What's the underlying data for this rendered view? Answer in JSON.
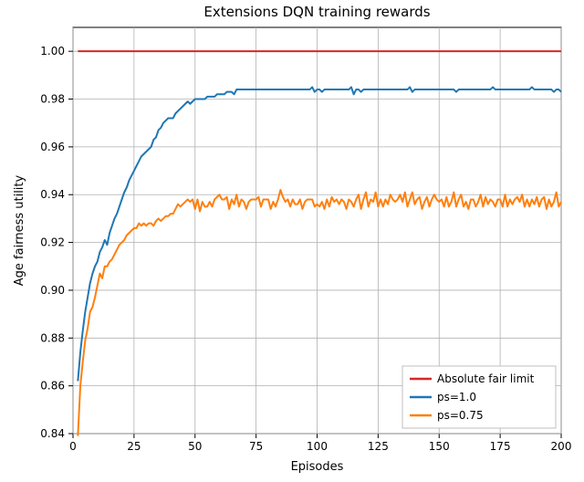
{
  "chart_data": {
    "type": "line",
    "title": "Extensions DQN training rewards",
    "xlabel": "Episodes",
    "ylabel": "Age fairness utility",
    "xlim": [
      0,
      200
    ],
    "ylim": [
      0.84,
      1.01
    ],
    "xticks": [
      0,
      25,
      50,
      75,
      100,
      125,
      150,
      175,
      200
    ],
    "yticks": [
      0.84,
      0.86,
      0.88,
      0.9,
      0.92,
      0.94,
      0.96,
      0.98,
      1.0
    ],
    "x": [
      2,
      3,
      4,
      5,
      6,
      7,
      8,
      9,
      10,
      11,
      12,
      13,
      14,
      15,
      16,
      17,
      18,
      19,
      20,
      21,
      22,
      23,
      24,
      25,
      26,
      27,
      28,
      29,
      30,
      31,
      32,
      33,
      34,
      35,
      36,
      37,
      38,
      39,
      40,
      41,
      42,
      43,
      44,
      45,
      46,
      47,
      48,
      49,
      50,
      51,
      52,
      53,
      54,
      55,
      56,
      57,
      58,
      59,
      60,
      61,
      62,
      63,
      64,
      65,
      66,
      67,
      68,
      69,
      70,
      71,
      72,
      73,
      74,
      75,
      76,
      77,
      78,
      79,
      80,
      81,
      82,
      83,
      84,
      85,
      86,
      87,
      88,
      89,
      90,
      91,
      92,
      93,
      94,
      95,
      96,
      97,
      98,
      99,
      100,
      101,
      102,
      103,
      104,
      105,
      106,
      107,
      108,
      109,
      110,
      111,
      112,
      113,
      114,
      115,
      116,
      117,
      118,
      119,
      120,
      121,
      122,
      123,
      124,
      125,
      126,
      127,
      128,
      129,
      130,
      131,
      132,
      133,
      134,
      135,
      136,
      137,
      138,
      139,
      140,
      141,
      142,
      143,
      144,
      145,
      146,
      147,
      148,
      149,
      150,
      151,
      152,
      153,
      154,
      155,
      156,
      157,
      158,
      159,
      160,
      161,
      162,
      163,
      164,
      165,
      166,
      167,
      168,
      169,
      170,
      171,
      172,
      173,
      174,
      175,
      176,
      177,
      178,
      179,
      180,
      181,
      182,
      183,
      184,
      185,
      186,
      187,
      188,
      189,
      190,
      191,
      192,
      193,
      194,
      195,
      196,
      197,
      198,
      199,
      200
    ],
    "series": [
      {
        "name": "Absolute fair limit",
        "color": "#d62728",
        "values": [
          1.0,
          1.0,
          1.0,
          1.0,
          1.0,
          1.0,
          1.0,
          1.0,
          1.0,
          1.0,
          1.0,
          1.0,
          1.0,
          1.0,
          1.0,
          1.0,
          1.0,
          1.0,
          1.0,
          1.0,
          1.0,
          1.0,
          1.0,
          1.0,
          1.0,
          1.0,
          1.0,
          1.0,
          1.0,
          1.0,
          1.0,
          1.0,
          1.0,
          1.0,
          1.0,
          1.0,
          1.0,
          1.0,
          1.0,
          1.0,
          1.0,
          1.0,
          1.0,
          1.0,
          1.0,
          1.0,
          1.0,
          1.0,
          1.0,
          1.0,
          1.0,
          1.0,
          1.0,
          1.0,
          1.0,
          1.0,
          1.0,
          1.0,
          1.0,
          1.0,
          1.0,
          1.0,
          1.0,
          1.0,
          1.0,
          1.0,
          1.0,
          1.0,
          1.0,
          1.0,
          1.0,
          1.0,
          1.0,
          1.0,
          1.0,
          1.0,
          1.0,
          1.0,
          1.0,
          1.0,
          1.0,
          1.0,
          1.0,
          1.0,
          1.0,
          1.0,
          1.0,
          1.0,
          1.0,
          1.0,
          1.0,
          1.0,
          1.0,
          1.0,
          1.0,
          1.0,
          1.0,
          1.0,
          1.0,
          1.0,
          1.0,
          1.0,
          1.0,
          1.0,
          1.0,
          1.0,
          1.0,
          1.0,
          1.0,
          1.0,
          1.0,
          1.0,
          1.0,
          1.0,
          1.0,
          1.0,
          1.0,
          1.0,
          1.0,
          1.0,
          1.0,
          1.0,
          1.0,
          1.0,
          1.0,
          1.0,
          1.0,
          1.0,
          1.0,
          1.0,
          1.0,
          1.0,
          1.0,
          1.0,
          1.0,
          1.0,
          1.0,
          1.0,
          1.0,
          1.0,
          1.0,
          1.0,
          1.0,
          1.0,
          1.0,
          1.0,
          1.0,
          1.0,
          1.0,
          1.0,
          1.0,
          1.0,
          1.0,
          1.0,
          1.0,
          1.0,
          1.0,
          1.0,
          1.0,
          1.0,
          1.0,
          1.0,
          1.0,
          1.0,
          1.0,
          1.0,
          1.0,
          1.0,
          1.0,
          1.0,
          1.0,
          1.0,
          1.0,
          1.0,
          1.0,
          1.0,
          1.0,
          1.0,
          1.0,
          1.0,
          1.0,
          1.0,
          1.0,
          1.0,
          1.0,
          1.0,
          1.0,
          1.0,
          1.0,
          1.0,
          1.0,
          1.0,
          1.0,
          1.0,
          1.0,
          1.0,
          1.0,
          1.0,
          1.0
        ]
      },
      {
        "name": "ps=1.0",
        "color": "#1f77b4",
        "values": [
          0.862,
          0.874,
          0.883,
          0.891,
          0.897,
          0.903,
          0.907,
          0.91,
          0.912,
          0.916,
          0.918,
          0.921,
          0.919,
          0.924,
          0.927,
          0.93,
          0.932,
          0.935,
          0.938,
          0.941,
          0.943,
          0.946,
          0.948,
          0.95,
          0.952,
          0.954,
          0.956,
          0.957,
          0.958,
          0.959,
          0.96,
          0.963,
          0.964,
          0.967,
          0.968,
          0.97,
          0.971,
          0.972,
          0.972,
          0.972,
          0.974,
          0.975,
          0.976,
          0.977,
          0.978,
          0.979,
          0.978,
          0.979,
          0.98,
          0.98,
          0.98,
          0.98,
          0.98,
          0.981,
          0.981,
          0.981,
          0.981,
          0.982,
          0.982,
          0.982,
          0.982,
          0.983,
          0.983,
          0.983,
          0.982,
          0.984,
          0.984,
          0.984,
          0.984,
          0.984,
          0.984,
          0.984,
          0.984,
          0.984,
          0.984,
          0.984,
          0.984,
          0.984,
          0.984,
          0.984,
          0.984,
          0.984,
          0.984,
          0.984,
          0.984,
          0.984,
          0.984,
          0.984,
          0.984,
          0.984,
          0.984,
          0.984,
          0.984,
          0.984,
          0.984,
          0.984,
          0.985,
          0.983,
          0.984,
          0.984,
          0.983,
          0.984,
          0.984,
          0.984,
          0.984,
          0.984,
          0.984,
          0.984,
          0.984,
          0.984,
          0.984,
          0.984,
          0.985,
          0.982,
          0.984,
          0.984,
          0.983,
          0.984,
          0.984,
          0.984,
          0.984,
          0.984,
          0.984,
          0.984,
          0.984,
          0.984,
          0.984,
          0.984,
          0.984,
          0.984,
          0.984,
          0.984,
          0.984,
          0.984,
          0.984,
          0.984,
          0.985,
          0.983,
          0.984,
          0.984,
          0.984,
          0.984,
          0.984,
          0.984,
          0.984,
          0.984,
          0.984,
          0.984,
          0.984,
          0.984,
          0.984,
          0.984,
          0.984,
          0.984,
          0.984,
          0.983,
          0.984,
          0.984,
          0.984,
          0.984,
          0.984,
          0.984,
          0.984,
          0.984,
          0.984,
          0.984,
          0.984,
          0.984,
          0.984,
          0.984,
          0.985,
          0.984,
          0.984,
          0.984,
          0.984,
          0.984,
          0.984,
          0.984,
          0.984,
          0.984,
          0.984,
          0.984,
          0.984,
          0.984,
          0.984,
          0.984,
          0.985,
          0.984,
          0.984,
          0.984,
          0.984,
          0.984,
          0.984,
          0.984,
          0.984,
          0.983,
          0.984,
          0.984,
          0.983
        ]
      },
      {
        "name": "ps=0.75",
        "color": "#ff7f0e",
        "values": [
          0.839,
          0.86,
          0.87,
          0.879,
          0.884,
          0.891,
          0.893,
          0.897,
          0.902,
          0.907,
          0.905,
          0.91,
          0.91,
          0.912,
          0.913,
          0.915,
          0.917,
          0.919,
          0.92,
          0.921,
          0.923,
          0.924,
          0.925,
          0.926,
          0.926,
          0.928,
          0.927,
          0.928,
          0.927,
          0.928,
          0.928,
          0.927,
          0.929,
          0.93,
          0.929,
          0.93,
          0.931,
          0.931,
          0.932,
          0.932,
          0.934,
          0.936,
          0.935,
          0.936,
          0.937,
          0.938,
          0.937,
          0.938,
          0.934,
          0.938,
          0.933,
          0.937,
          0.935,
          0.935,
          0.937,
          0.935,
          0.938,
          0.939,
          0.94,
          0.938,
          0.938,
          0.939,
          0.934,
          0.938,
          0.936,
          0.94,
          0.935,
          0.938,
          0.937,
          0.934,
          0.937,
          0.938,
          0.938,
          0.938,
          0.939,
          0.935,
          0.938,
          0.938,
          0.938,
          0.934,
          0.937,
          0.935,
          0.938,
          0.942,
          0.939,
          0.937,
          0.938,
          0.935,
          0.938,
          0.936,
          0.936,
          0.938,
          0.934,
          0.937,
          0.938,
          0.938,
          0.938,
          0.935,
          0.936,
          0.935,
          0.937,
          0.934,
          0.938,
          0.935,
          0.939,
          0.937,
          0.938,
          0.936,
          0.938,
          0.937,
          0.934,
          0.938,
          0.937,
          0.935,
          0.938,
          0.94,
          0.934,
          0.938,
          0.941,
          0.935,
          0.938,
          0.937,
          0.941,
          0.935,
          0.938,
          0.935,
          0.938,
          0.936,
          0.94,
          0.938,
          0.937,
          0.938,
          0.94,
          0.937,
          0.941,
          0.935,
          0.938,
          0.941,
          0.936,
          0.938,
          0.939,
          0.934,
          0.937,
          0.939,
          0.935,
          0.938,
          0.94,
          0.938,
          0.937,
          0.938,
          0.935,
          0.939,
          0.935,
          0.937,
          0.941,
          0.935,
          0.938,
          0.94,
          0.935,
          0.937,
          0.934,
          0.938,
          0.938,
          0.935,
          0.937,
          0.94,
          0.935,
          0.939,
          0.936,
          0.938,
          0.937,
          0.935,
          0.938,
          0.938,
          0.935,
          0.94,
          0.935,
          0.938,
          0.936,
          0.938,
          0.939,
          0.937,
          0.94,
          0.935,
          0.938,
          0.935,
          0.938,
          0.936,
          0.939,
          0.935,
          0.938,
          0.939,
          0.934,
          0.938,
          0.935,
          0.937,
          0.941,
          0.935,
          0.937
        ]
      }
    ],
    "legend": {
      "position": "lower right",
      "entries": [
        "Absolute fair limit",
        "ps=1.0",
        "ps=0.75"
      ]
    }
  }
}
